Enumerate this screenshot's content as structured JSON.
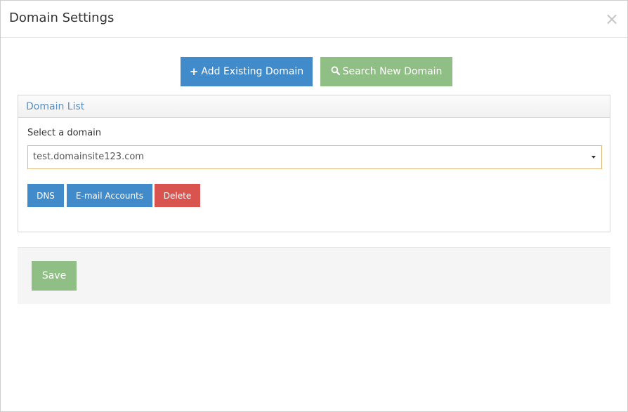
{
  "modal": {
    "title": "Domain Settings",
    "close_glyph": "×"
  },
  "actions": {
    "add_icon": "+",
    "add_label": "Add Existing Domain",
    "search_icon": "search-icon",
    "search_label": "Search New Domain"
  },
  "panel": {
    "heading": "Domain List",
    "select_label": "Select a domain",
    "selected_domain": "test.domainsite123.com",
    "buttons": {
      "dns": "DNS",
      "email": "E-mail Accounts",
      "delete": "Delete"
    }
  },
  "footer": {
    "save_label": "Save"
  },
  "colors": {
    "primary": "#428bca",
    "success": "#8fbf85",
    "danger": "#d9534f",
    "panel_heading_text": "#5b8fc0",
    "select_border": "#e4b77a"
  }
}
